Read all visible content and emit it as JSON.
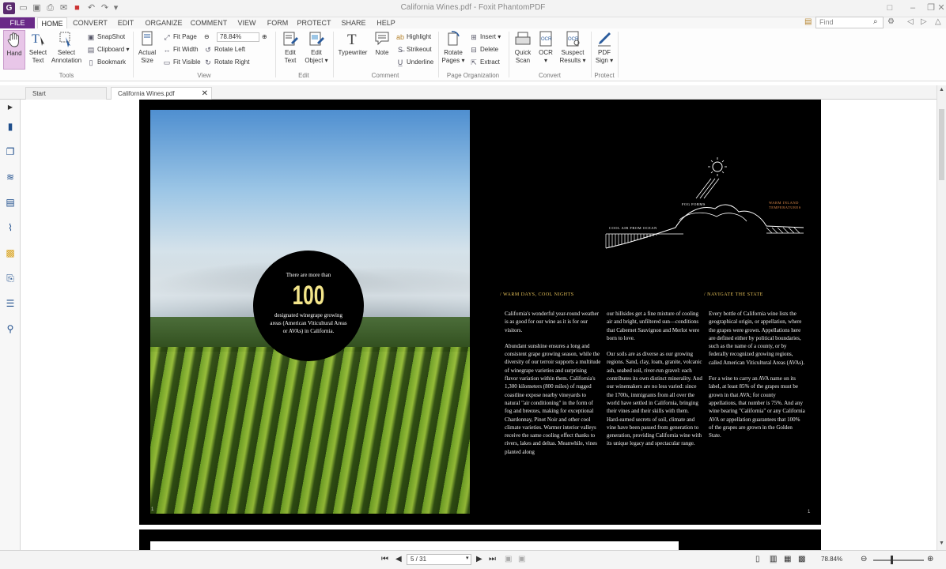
{
  "window": {
    "title": "California Wines.pdf - Foxit PhantomPDF",
    "app_logo": "G"
  },
  "menu": {
    "file": "FILE",
    "items": [
      "HOME",
      "CONVERT",
      "EDIT",
      "ORGANIZE",
      "COMMENT",
      "VIEW",
      "FORM",
      "PROTECT",
      "SHARE",
      "HELP"
    ],
    "search_placeholder": "Find"
  },
  "ribbon": {
    "tools": {
      "hand": "Hand",
      "select_text": "Select Text",
      "select_annotation": "Select Annotation",
      "snapshot": "SnapShot",
      "clipboard": "Clipboard",
      "bookmark": "Bookmark",
      "label": "Tools"
    },
    "view": {
      "actual_size": "Actual Size",
      "fit_page": "Fit Page",
      "fit_width": "Fit Width",
      "fit_visible": "Fit Visible",
      "zoom": "78.84%",
      "rotate_left": "Rotate Left",
      "rotate_right": "Rotate Right",
      "label": "View"
    },
    "edit": {
      "edit_text": "Edit Text",
      "edit_object": "Edit Object",
      "label": "Edit"
    },
    "comment": {
      "typewriter": "Typewriter",
      "note": "Note",
      "highlight": "Highlight",
      "strikeout": "Strikeout",
      "underline": "Underline",
      "label": "Comment"
    },
    "page_org": {
      "rotate_pages": "Rotate Pages",
      "insert": "Insert",
      "delete": "Delete",
      "extract": "Extract",
      "label": "Page Organization"
    },
    "convert": {
      "quick_scan": "Quick Scan",
      "ocr": "OCR",
      "suspect_results": "Suspect Results",
      "label": "Convert"
    },
    "protect": {
      "pdf_sign": "PDF Sign",
      "label": "Protect"
    }
  },
  "tabs": [
    {
      "label": "Start"
    },
    {
      "label": "California Wines.pdf"
    }
  ],
  "document": {
    "circle": {
      "pre": "There are more than",
      "number": "100",
      "post": "designated winegrape growing areas (American Viticultural Areas or AVAs) in California."
    },
    "diagram": {
      "fog_forms": "FOG FORMS",
      "warm_inland": "WARM INLAND TEMPERATURES",
      "cool_air": "COOL AIR FROM OCEAN"
    },
    "heading_1": "/ WARM DAYS, COOL NIGHTS",
    "heading_2": "/ NAVIGATE THE STATE",
    "col1": [
      "California's wonderful year-round weather is as good for our wine as it is for our visitors.",
      "Abundant sunshine ensures a long and consistent grape growing season, while the diversity of our terroir supports a multitude of winegrape varieties and surprising flavor variation within them. California's 1,300 kilometers (800 miles) of rugged coastline expose nearby vineyards to natural \"air conditioning\" in the form of fog and breezes, making for exceptional Chardonnay, Pinot Noir and other cool climate varieties. Warmer interior valleys receive the same cooling effect thanks to rivers, lakes and deltas. Meanwhile, vines planted along"
    ],
    "col2": [
      "our hillsides get a fine mixture of cooling air and bright, unfiltered sun—conditions that Cabernet Sauvignon and Merlot were born to love.",
      "Our soils are as diverse as our growing regions. Sand, clay, loam, granite, volcanic ash, seabed soil, river-run gravel: each contributes its own distinct minerality. And our winemakers are no less varied: since the 1700s, immigrants from all over the world have settled in California, bringing their vines and their skills with them. Hard-earned secrets of soil, climate and vine have been passed from generation to generation, providing California wine with its unique legacy and spectacular range."
    ],
    "col3": [
      "Every bottle of California wine lists the geographical origin, or appellation, where the grapes were grown. Appellations here are defined either by political boundaries, such as the name of a county, or by federally recognized growing regions, called American Viticultural Areas (AVAs).",
      "For a wine to carry an AVA name on its label, at least 85% of the grapes must be grown in that AVA; for county appellations, that number is 75%. And any wine bearing \"California\" or any California AVA or appellation guarantees that 100% of the grapes are grown in the Golden State."
    ],
    "page_number": "1",
    "page_number_left": "1"
  },
  "status": {
    "page": "5 / 31",
    "zoom": "78.84%"
  }
}
